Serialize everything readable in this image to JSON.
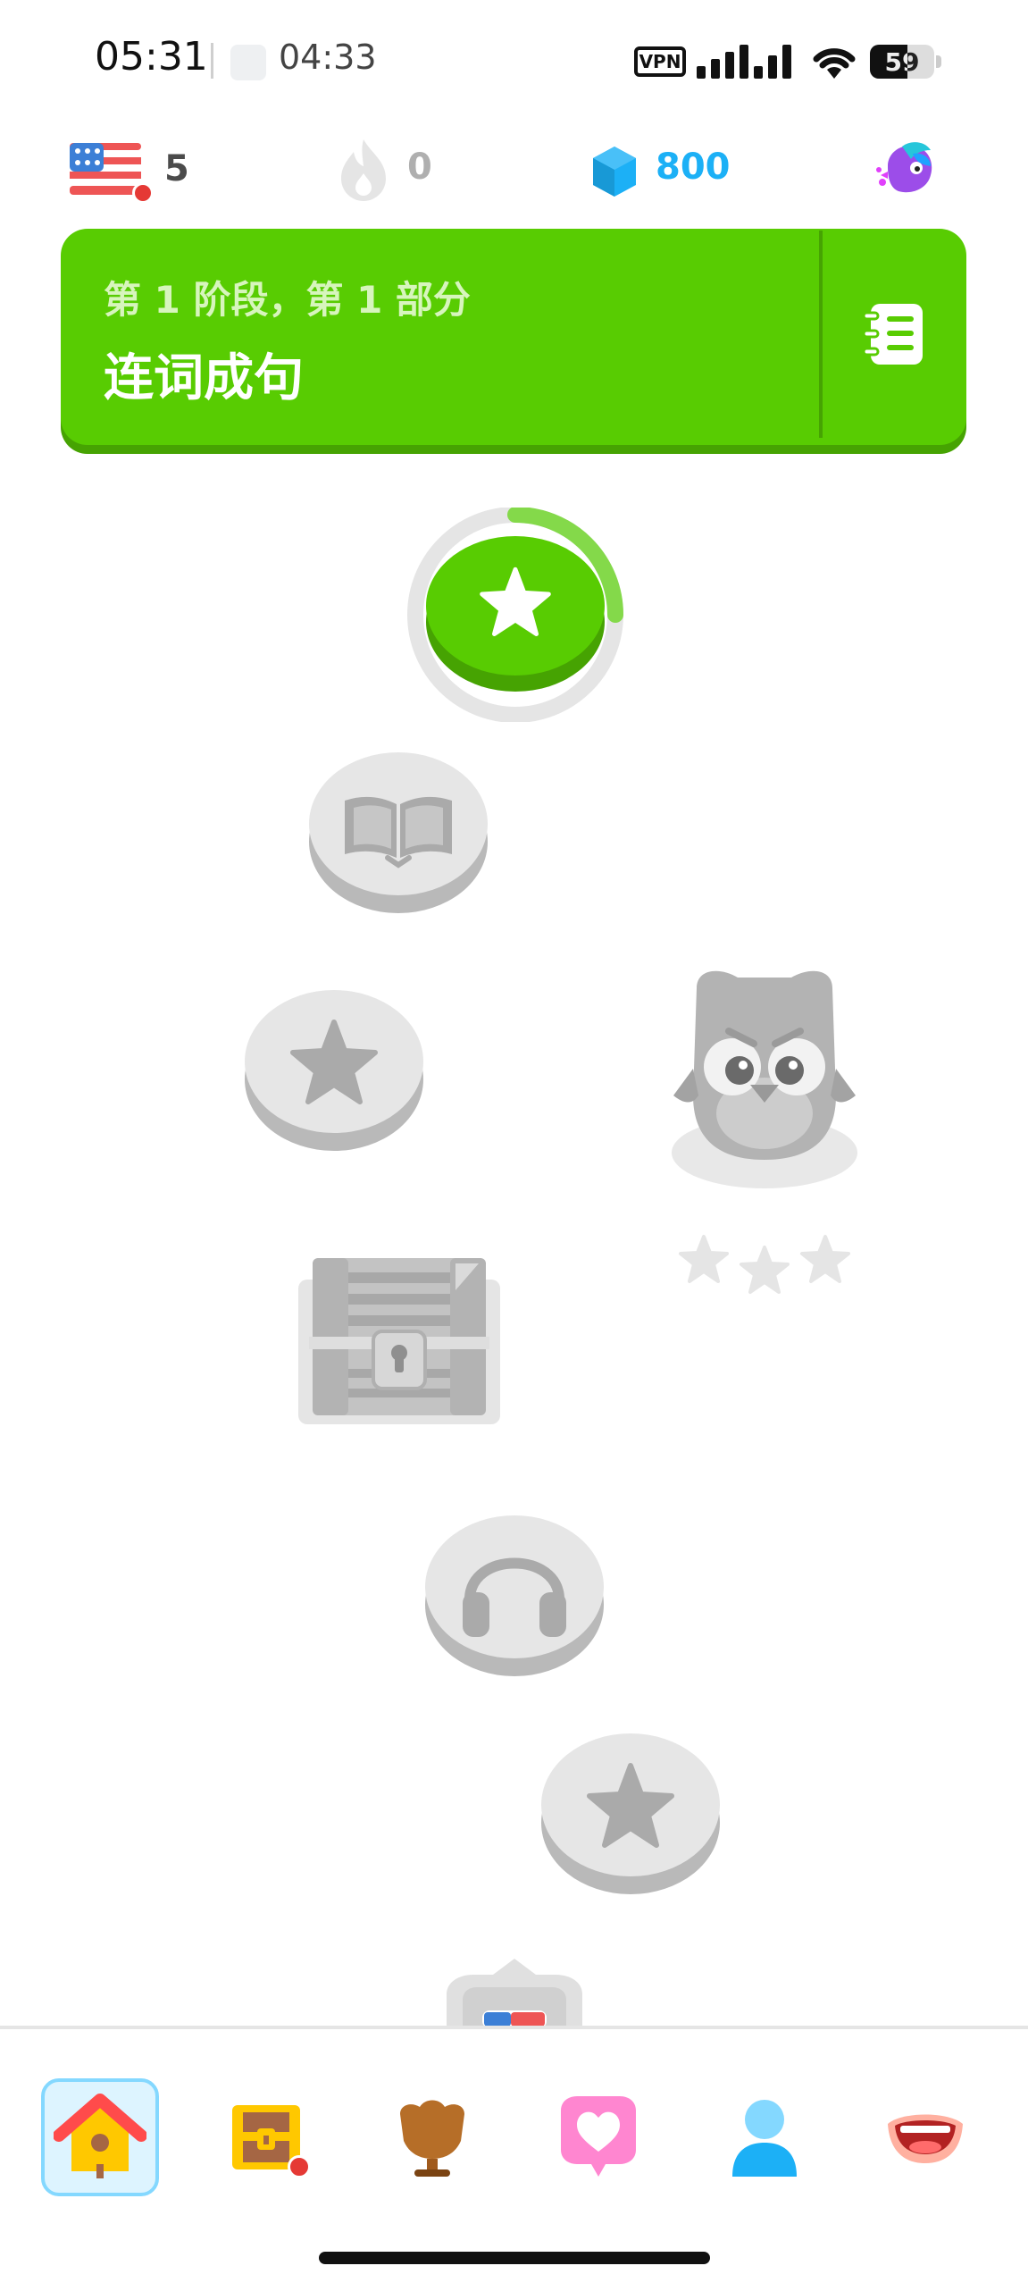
{
  "status_bar": {
    "time": "05:31",
    "timer": "04:33",
    "vpn": "VPN",
    "battery_level": "59",
    "battery_fraction": 0.59
  },
  "stats": {
    "streak_count": "5",
    "streak_flag_icon": "us-flag-icon",
    "energy_count": "0",
    "gems_count": "800",
    "gems_color": "#1cb0f6"
  },
  "unit": {
    "subtitle": "第 1 阶段，第 1 部分",
    "title": "连词成句",
    "guidebook_icon": "notebook-icon",
    "color": "#58cc02"
  },
  "path": {
    "current_node_icon": "star-icon",
    "current_node_progress": 0.25,
    "nodes": [
      {
        "icon": "star-icon",
        "state": "active"
      },
      {
        "icon": "book-icon",
        "state": "locked"
      },
      {
        "icon": "star-icon",
        "state": "locked"
      },
      {
        "icon": "chest-icon",
        "state": "locked"
      },
      {
        "icon": "headphones-icon",
        "state": "locked"
      },
      {
        "icon": "star-icon",
        "state": "locked"
      },
      {
        "icon": "trophy-icon",
        "state": "locked"
      }
    ],
    "character": {
      "icon": "owl-character-icon",
      "stars": 3
    }
  },
  "bottom_nav": {
    "items": [
      {
        "icon": "home-icon",
        "active": true
      },
      {
        "icon": "quests-chest-icon",
        "active": false,
        "badge": true
      },
      {
        "icon": "leaderboard-icon",
        "active": false
      },
      {
        "icon": "hearts-icon",
        "active": false
      },
      {
        "icon": "profile-icon",
        "active": false
      },
      {
        "icon": "practice-mouth-icon",
        "active": false
      }
    ]
  }
}
